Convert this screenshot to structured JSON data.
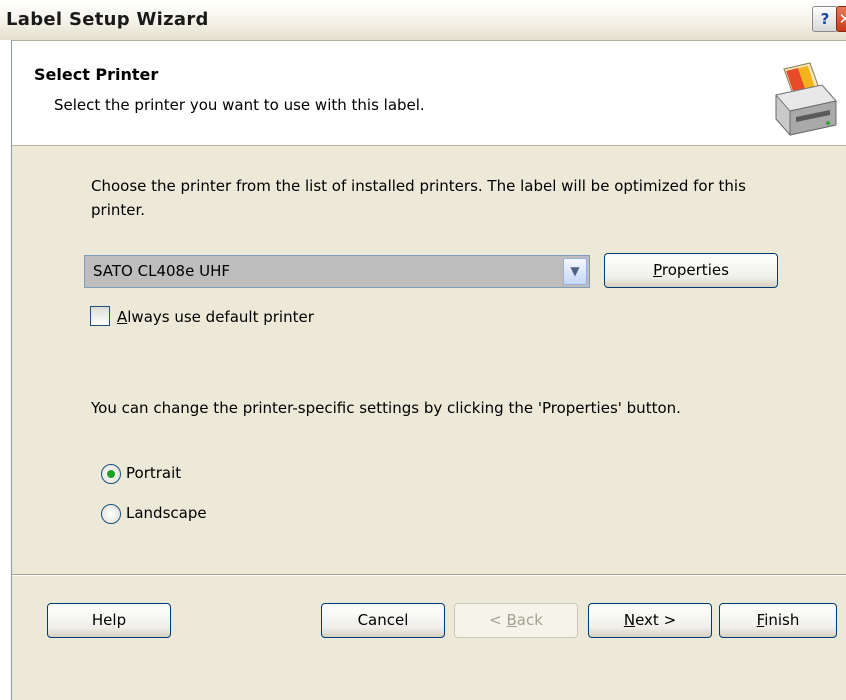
{
  "window": {
    "title": "Label Setup Wizard",
    "help_button": "?",
    "close_button": "✕"
  },
  "header": {
    "title": "Select Printer",
    "subtitle": "Select the printer you want to use with this label.",
    "icon": "printer-icon"
  },
  "main": {
    "description": "Choose the printer from the list of installed printers. The label will be optimized for this printer.",
    "printer_select": {
      "selected": "SATO CL408e UHF"
    },
    "properties_button": {
      "accel": "P",
      "rest": "roperties"
    },
    "always_default": {
      "checked": false,
      "accel": "A",
      "rest": "lways use default printer"
    },
    "info_text": "You can change the printer-specific settings by clicking the 'Properties' button.",
    "orientation": {
      "options": [
        "Portrait",
        "Landscape"
      ],
      "selected": "Portrait"
    }
  },
  "footer": {
    "help_label": "Help",
    "cancel_label": "Cancel",
    "back_prefix": "< ",
    "back_accel": "B",
    "back_rest": "ack",
    "next_accel": "N",
    "next_rest": "ext >",
    "finish_accel": "F",
    "finish_rest": "inish"
  },
  "colors": {
    "dialog_bg": "#ece9d8",
    "radio_selected": "#21a121"
  }
}
